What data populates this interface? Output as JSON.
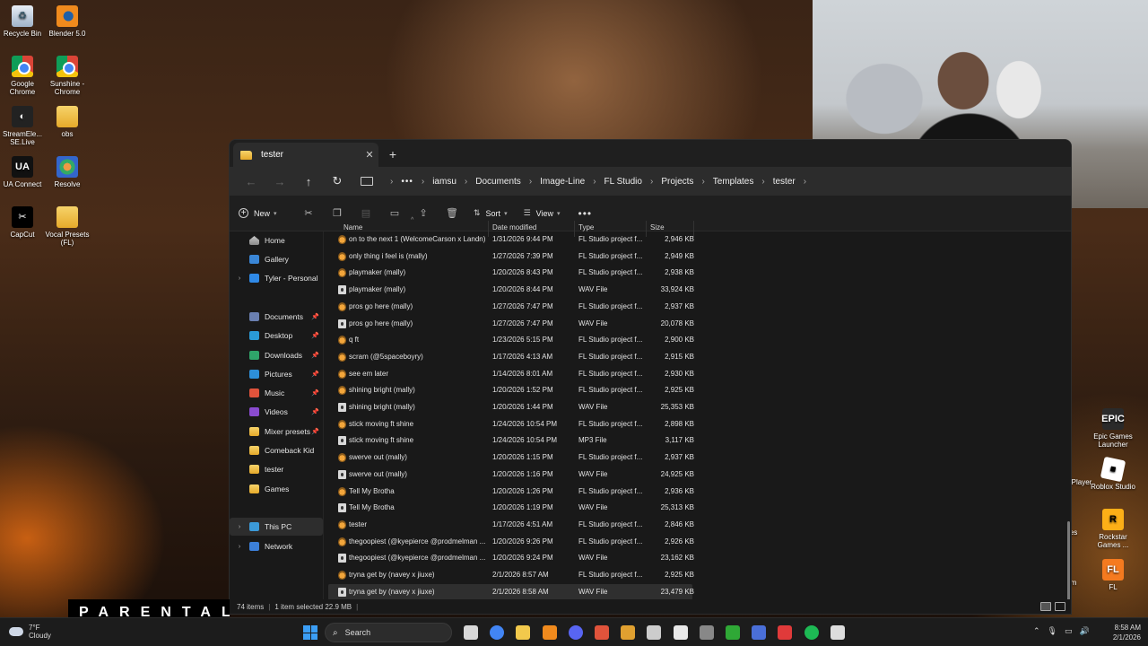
{
  "desktop": {
    "icons_left": [
      {
        "label": "Recycle Bin",
        "icon": "recycle-bin-icon",
        "glyph": "♻"
      },
      {
        "label": "Blender 5.0",
        "icon": "blender-icon",
        "glyph": ""
      },
      {
        "label": "Google Chrome",
        "icon": "chrome-icon",
        "glyph": ""
      },
      {
        "label": "Sunshine - Chrome",
        "icon": "chrome-icon",
        "glyph": ""
      },
      {
        "label": "StreamEle... SE.Live",
        "icon": "streamelements-icon",
        "glyph": "◐"
      },
      {
        "label": "obs",
        "icon": "folder-icon",
        "glyph": ""
      },
      {
        "label": "UA Connect",
        "icon": "ua-connect-icon",
        "glyph": "UA"
      },
      {
        "label": "Resolve",
        "icon": "resolve-icon",
        "glyph": ""
      },
      {
        "label": "CapCut",
        "icon": "capcut-icon",
        "glyph": "✂"
      },
      {
        "label": "Vocal Presets (FL)",
        "icon": "folder-icon",
        "glyph": ""
      }
    ],
    "icons_right": [
      {
        "label": "Epic Games Launcher",
        "icon": "epic-games-icon",
        "glyph": "EPIC"
      },
      {
        "label": "Roblox Studio",
        "icon": "roblox-icon",
        "glyph": "■"
      },
      {
        "label": "Rockstar Games ...",
        "icon": "rockstar-icon",
        "glyph": "R"
      },
      {
        "label": "FL",
        "icon": "fl-studio-icon",
        "glyph": "FL"
      }
    ],
    "partial_labels": [
      "Player",
      "es",
      "m"
    ],
    "overlay_text": "PARENTAL"
  },
  "explorer": {
    "tab_title": "tester",
    "breadcrumbs": [
      "iamsu",
      "Documents",
      "Image-Line",
      "FL Studio",
      "Projects",
      "Templates",
      "tester"
    ],
    "toolbar": {
      "new_label": "New",
      "sort_label": "Sort",
      "view_label": "View",
      "more": "•••"
    },
    "sidebar": {
      "items": [
        {
          "label": "Home",
          "icon": "home-icon",
          "cls": "ic-home",
          "chevron": "",
          "pin": ""
        },
        {
          "label": "Gallery",
          "icon": "gallery-icon",
          "cls": "ic-gallery",
          "chevron": "",
          "pin": ""
        },
        {
          "label": "Tyler - Personal",
          "icon": "onedrive-icon",
          "cls": "ic-cloud",
          "chevron": "›",
          "pin": ""
        },
        {
          "label": "Documents",
          "icon": "documents-icon",
          "cls": "ic-doc",
          "chevron": "",
          "pin": "📌"
        },
        {
          "label": "Desktop",
          "icon": "desktop-icon",
          "cls": "ic-desk",
          "chevron": "",
          "pin": "📌"
        },
        {
          "label": "Downloads",
          "icon": "downloads-icon",
          "cls": "ic-dl",
          "chevron": "",
          "pin": "📌"
        },
        {
          "label": "Pictures",
          "icon": "pictures-icon",
          "cls": "ic-pic",
          "chevron": "",
          "pin": "📌"
        },
        {
          "label": "Music",
          "icon": "music-icon",
          "cls": "ic-music",
          "chevron": "",
          "pin": "📌"
        },
        {
          "label": "Videos",
          "icon": "videos-icon",
          "cls": "ic-video",
          "chevron": "",
          "pin": "📌"
        },
        {
          "label": "Mixer presets",
          "icon": "folder-icon",
          "cls": "ic-folder",
          "chevron": "",
          "pin": "📌"
        },
        {
          "label": "Comeback Kid",
          "icon": "folder-icon",
          "cls": "ic-folder",
          "chevron": "",
          "pin": ""
        },
        {
          "label": "tester",
          "icon": "folder-icon",
          "cls": "ic-folder",
          "chevron": "",
          "pin": ""
        },
        {
          "label": "Games",
          "icon": "folder-icon",
          "cls": "ic-folder",
          "chevron": "",
          "pin": ""
        },
        {
          "label": "This PC",
          "icon": "this-pc-icon",
          "cls": "ic-pc",
          "chevron": "›",
          "pin": "",
          "active": true
        },
        {
          "label": "Network",
          "icon": "network-icon",
          "cls": "ic-net",
          "chevron": "›",
          "pin": ""
        }
      ]
    },
    "columns": {
      "name": "Name",
      "date": "Date modified",
      "type": "Type",
      "size": "Size"
    },
    "files": [
      {
        "name": "on to the next 1 (WelcomeCarson x Landn)",
        "date": "1/31/2026 9:44 PM",
        "type": "FL Studio project f...",
        "size": "2,946 KB",
        "kind": "flp"
      },
      {
        "name": "only thing i feel is (mally)",
        "date": "1/27/2026 7:39 PM",
        "type": "FL Studio project f...",
        "size": "2,949 KB",
        "kind": "flp"
      },
      {
        "name": "playmaker (mally)",
        "date": "1/20/2026 8:43 PM",
        "type": "FL Studio project f...",
        "size": "2,938 KB",
        "kind": "flp"
      },
      {
        "name": "playmaker (mally)",
        "date": "1/20/2026 8:44 PM",
        "type": "WAV File",
        "size": "33,924 KB",
        "kind": "wav"
      },
      {
        "name": "pros go here (mally)",
        "date": "1/27/2026 7:47 PM",
        "type": "FL Studio project f...",
        "size": "2,937 KB",
        "kind": "flp"
      },
      {
        "name": "pros go here (mally)",
        "date": "1/27/2026 7:47 PM",
        "type": "WAV File",
        "size": "20,078 KB",
        "kind": "wav"
      },
      {
        "name": "q ft",
        "date": "1/23/2026 5:15 PM",
        "type": "FL Studio project f...",
        "size": "2,900 KB",
        "kind": "flp"
      },
      {
        "name": "scram (@5spaceboyry)",
        "date": "1/17/2026 4:13 AM",
        "type": "FL Studio project f...",
        "size": "2,915 KB",
        "kind": "flp"
      },
      {
        "name": "see em later",
        "date": "1/14/2026 8:01 AM",
        "type": "FL Studio project f...",
        "size": "2,930 KB",
        "kind": "flp"
      },
      {
        "name": "shining bright (mally)",
        "date": "1/20/2026 1:52 PM",
        "type": "FL Studio project f...",
        "size": "2,925 KB",
        "kind": "flp"
      },
      {
        "name": "shining bright (mally)",
        "date": "1/20/2026 1:44 PM",
        "type": "WAV File",
        "size": "25,353 KB",
        "kind": "wav"
      },
      {
        "name": "stick moving ft shine",
        "date": "1/24/2026 10:54 PM",
        "type": "FL Studio project f...",
        "size": "2,898 KB",
        "kind": "flp"
      },
      {
        "name": "stick moving ft shine",
        "date": "1/24/2026 10:54 PM",
        "type": "MP3 File",
        "size": "3,117 KB",
        "kind": "wav"
      },
      {
        "name": "swerve out (mally)",
        "date": "1/20/2026 1:15 PM",
        "type": "FL Studio project f...",
        "size": "2,937 KB",
        "kind": "flp"
      },
      {
        "name": "swerve out (mally)",
        "date": "1/20/2026 1:16 PM",
        "type": "WAV File",
        "size": "24,925 KB",
        "kind": "wav"
      },
      {
        "name": "Tell My Brotha",
        "date": "1/20/2026 1:26 PM",
        "type": "FL Studio project f...",
        "size": "2,936 KB",
        "kind": "flp"
      },
      {
        "name": "Tell My Brotha",
        "date": "1/20/2026 1:19 PM",
        "type": "WAV File",
        "size": "25,313 KB",
        "kind": "wav"
      },
      {
        "name": "tester",
        "date": "1/17/2026 4:51 AM",
        "type": "FL Studio project f...",
        "size": "2,846 KB",
        "kind": "flp"
      },
      {
        "name": "thegoopiest (@kyepierce @prodmelman ...",
        "date": "1/20/2026 9:26 PM",
        "type": "FL Studio project f...",
        "size": "2,926 KB",
        "kind": "flp"
      },
      {
        "name": "thegoopiest (@kyepierce @prodmelman ...",
        "date": "1/20/2026 9:24 PM",
        "type": "WAV File",
        "size": "23,162 KB",
        "kind": "wav"
      },
      {
        "name": "tryna get by (navey x jiuxe)",
        "date": "2/1/2026 8:57 AM",
        "type": "FL Studio project f...",
        "size": "2,925 KB",
        "kind": "flp"
      },
      {
        "name": "tryna get by (navey x jiuxe)",
        "date": "2/1/2026 8:58 AM",
        "type": "WAV File",
        "size": "23,479 KB",
        "kind": "wav",
        "selected": true
      }
    ],
    "status": {
      "items": "74 items",
      "selected": "1 item selected  22.9 MB"
    }
  },
  "taskbar": {
    "weather_temp": "7°F",
    "weather_desc": "Cloudy",
    "search_placeholder": "Search",
    "apps": [
      {
        "icon": "task-view-icon",
        "color": "#d8d8d8"
      },
      {
        "icon": "chrome-icon",
        "color": "#4285f4"
      },
      {
        "icon": "file-explorer-icon",
        "color": "#f2c94c"
      },
      {
        "icon": "fl-studio-icon",
        "color": "#f08a1d"
      },
      {
        "icon": "discord-icon",
        "color": "#5865f2"
      },
      {
        "icon": "app-icon",
        "color": "#e0533b"
      },
      {
        "icon": "app-icon",
        "color": "#e0a030"
      },
      {
        "icon": "obs-icon",
        "color": "#cccccc"
      },
      {
        "icon": "app-icon",
        "color": "#e8e8e8"
      },
      {
        "icon": "app-icon",
        "color": "#888888"
      },
      {
        "icon": "xbox-icon",
        "color": "#2fa836"
      },
      {
        "icon": "app-icon",
        "color": "#4a6fd8"
      },
      {
        "icon": "app-icon",
        "color": "#e03a3a"
      },
      {
        "icon": "spotify-icon",
        "color": "#1db954"
      },
      {
        "icon": "app-icon",
        "color": "#dddddd"
      }
    ],
    "time": "8:58 AM",
    "date": "2/1/2026"
  }
}
